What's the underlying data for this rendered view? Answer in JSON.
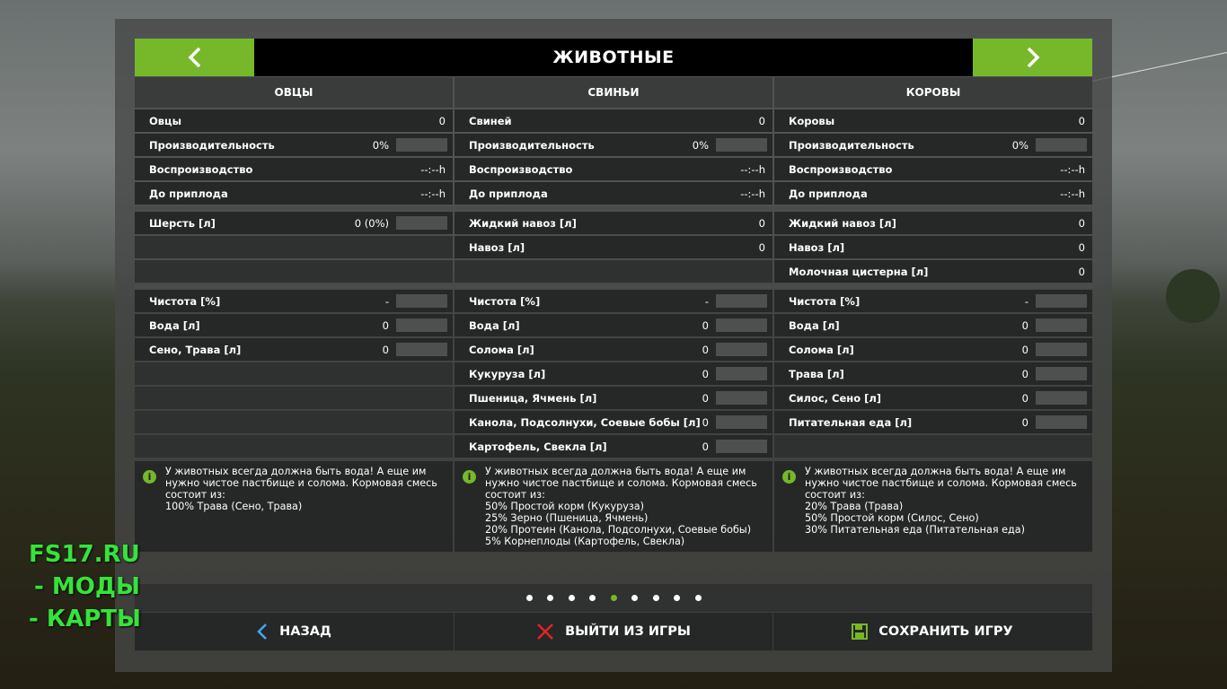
{
  "header": {
    "title": "ЖИВОТНЫЕ"
  },
  "columns": [
    {
      "name": "ОВЦЫ",
      "stats": [
        {
          "label": "Овцы",
          "value": "0",
          "bar": false
        },
        {
          "label": "Производительность",
          "value": "0%",
          "bar": true
        },
        {
          "label": "Воспроизводство",
          "value": "--:--h",
          "bar": false
        },
        {
          "label": "До приплода",
          "value": "--:--h",
          "bar": false
        }
      ],
      "products": [
        {
          "label": "Шерсть [л]",
          "value": "0 (0%)",
          "bar": true
        }
      ],
      "foods": [
        {
          "label": "Чистота [%]",
          "value": "-",
          "bar": true
        },
        {
          "label": "Вода [л]",
          "value": "0",
          "bar": true
        },
        {
          "label": "Сено, Трава [л]",
          "value": "0",
          "bar": true
        }
      ],
      "info": "У животных всегда должна быть вода! А еще им нужно чистое пастбище и солома. Кормовая смесь состоит из:\n100% Трава (Сено, Трава)"
    },
    {
      "name": "СВИНЬИ",
      "stats": [
        {
          "label": "Свиней",
          "value": "0",
          "bar": false
        },
        {
          "label": "Производительность",
          "value": "0%",
          "bar": true
        },
        {
          "label": "Воспроизводство",
          "value": "--:--h",
          "bar": false
        },
        {
          "label": "До приплода",
          "value": "--:--h",
          "bar": false
        }
      ],
      "products": [
        {
          "label": "Жидкий навоз [л]",
          "value": "0",
          "bar": false
        },
        {
          "label": "Навоз [л]",
          "value": "0",
          "bar": false
        }
      ],
      "foods": [
        {
          "label": "Чистота [%]",
          "value": "-",
          "bar": true
        },
        {
          "label": "Вода [л]",
          "value": "0",
          "bar": true
        },
        {
          "label": "Солома [л]",
          "value": "0",
          "bar": true
        },
        {
          "label": "Кукуруза [л]",
          "value": "0",
          "bar": true
        },
        {
          "label": "Пшеница, Ячмень [л]",
          "value": "0",
          "bar": true
        },
        {
          "label": "Канола, Подсолнухи, Соевые бобы [л]",
          "value": "0",
          "bar": true
        },
        {
          "label": "Картофель, Свекла [л]",
          "value": "0",
          "bar": true
        }
      ],
      "info": "У животных всегда должна быть вода! А еще им нужно чистое пастбище и солома. Кормовая смесь состоит из:\n50% Простой корм (Кукуруза)\n25% Зерно (Пшеница, Ячмень)\n20% Протеин (Канола, Подсолнухи, Соевые бобы)\n5% Корнеплоды (Картофель, Свекла)"
    },
    {
      "name": "КОРОВЫ",
      "stats": [
        {
          "label": "Коровы",
          "value": "0",
          "bar": false
        },
        {
          "label": "Производительность",
          "value": "0%",
          "bar": true
        },
        {
          "label": "Воспроизводство",
          "value": "--:--h",
          "bar": false
        },
        {
          "label": "До приплода",
          "value": "--:--h",
          "bar": false
        }
      ],
      "products": [
        {
          "label": "Жидкий навоз [л]",
          "value": "0",
          "bar": false
        },
        {
          "label": "Навоз [л]",
          "value": "0",
          "bar": false
        },
        {
          "label": "Молочная цистерна [л]",
          "value": "0",
          "bar": false
        }
      ],
      "foods": [
        {
          "label": "Чистота [%]",
          "value": "-",
          "bar": true
        },
        {
          "label": "Вода [л]",
          "value": "0",
          "bar": true
        },
        {
          "label": "Солома [л]",
          "value": "0",
          "bar": true
        },
        {
          "label": "Трава [л]",
          "value": "0",
          "bar": true
        },
        {
          "label": "Силос, Сено [л]",
          "value": "0",
          "bar": true
        },
        {
          "label": "Питательная еда [л]",
          "value": "0",
          "bar": true
        }
      ],
      "info": "У животных всегда должна быть вода! А еще им нужно чистое пастбище и солома. Кормовая смесь состоит из:\n20% Трава (Трава)\n50% Простой корм (Силос, Сено)\n30% Питательная еда (Питательная еда)"
    }
  ],
  "pagination": {
    "count": 9,
    "active": 4
  },
  "footer": {
    "back": "НАЗАД",
    "quit": "ВЫЙТИ ИЗ ИГРЫ",
    "save": "СОХРАНИТЬ ИГРУ"
  },
  "watermark": [
    "FS17.RU",
    "- МОДЫ",
    "- КАРТЫ"
  ],
  "colors": {
    "accent": "#76b82a",
    "quit_icon": "#e52421",
    "back_icon": "#3fa9f5"
  }
}
